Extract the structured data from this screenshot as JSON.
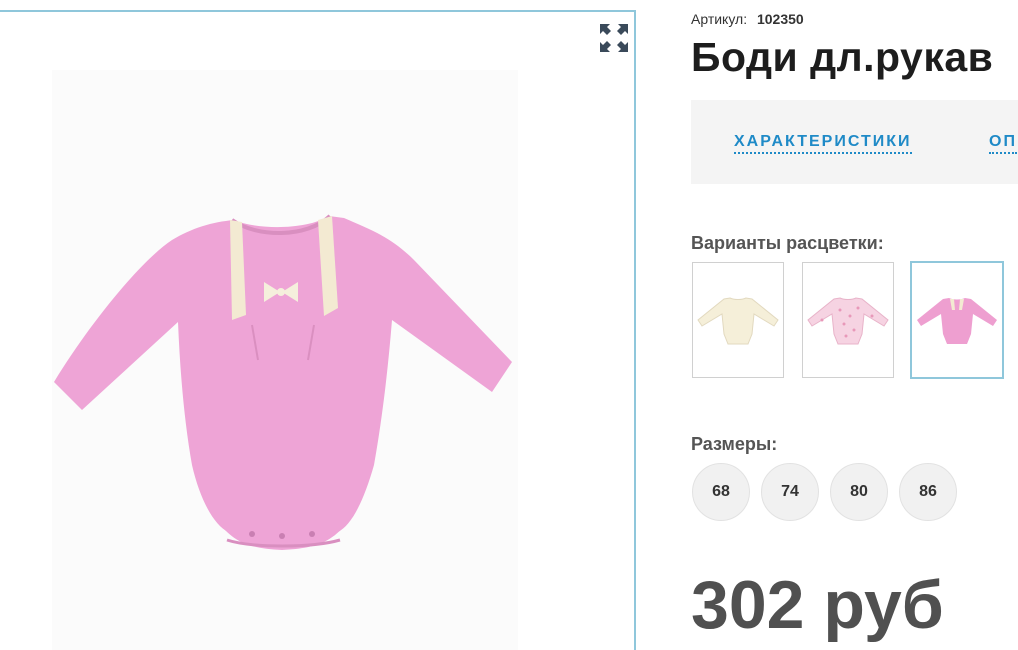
{
  "product": {
    "sku_label": "Артикул:",
    "sku_value": "102350",
    "title": "Боди дл.рукав",
    "price": "302 руб"
  },
  "tabs": [
    {
      "label": "ХАРАКТЕРИСТИКИ"
    },
    {
      "label": "ОП"
    }
  ],
  "colors": {
    "label": "Варианты расцветки:",
    "swatches": [
      {
        "color": "#f5efd9",
        "icon": "bodysuit-cream-icon"
      },
      {
        "color": "#f3c9da",
        "icon": "bodysuit-pink-print-icon"
      },
      {
        "color": "#ee9fd0",
        "icon": "bodysuit-pink-icon",
        "selected": true
      }
    ]
  },
  "sizes": {
    "label": "Размеры:",
    "items": [
      "68",
      "74",
      "80",
      "86"
    ]
  },
  "gallery": {
    "icon": "expand-icon",
    "photo_color": "#efa6d4"
  },
  "theme": {
    "accent": "#1f8ac7",
    "frame": "#8fc7db"
  }
}
